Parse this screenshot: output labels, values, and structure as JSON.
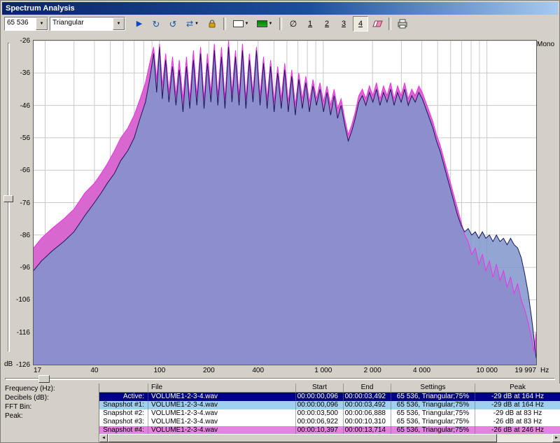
{
  "window": {
    "title": "Spectrum Analysis"
  },
  "icons": {
    "dropdown": "▼",
    "play": "▶",
    "refresh_cw": "↻",
    "refresh_ccw": "↺",
    "swap": "⇄",
    "no_symbol": "∅",
    "arrow_left": "◄",
    "arrow_right": "►"
  },
  "toolbar": {
    "fft_size_value": "65 536",
    "window_value": "Triangular",
    "snapshot_buttons": [
      "1",
      "2",
      "3",
      "4"
    ],
    "active_snapshot": "4"
  },
  "chart": {
    "mono_label": "Mono",
    "db_label": "dB",
    "hz_label": "Hz",
    "y_tick_labels": [
      "-26",
      "-36",
      "-46",
      "-56",
      "-66",
      "-76",
      "-86",
      "-96",
      "-106",
      "-116",
      "-126"
    ],
    "x_tick_labels": [
      {
        "f": 17,
        "label": "17"
      },
      {
        "f": 40,
        "label": "40"
      },
      {
        "f": 100,
        "label": "100"
      },
      {
        "f": 200,
        "label": "200"
      },
      {
        "f": 400,
        "label": "400"
      },
      {
        "f": 1000,
        "label": "1 000"
      },
      {
        "f": 2000,
        "label": "2 000"
      },
      {
        "f": 4000,
        "label": "4 000"
      },
      {
        "f": 10000,
        "label": "10 000"
      },
      {
        "f": 19997,
        "label": "19 997"
      }
    ],
    "grid_freqs": [
      20,
      30,
      40,
      50,
      60,
      70,
      80,
      90,
      100,
      200,
      300,
      400,
      500,
      600,
      700,
      800,
      900,
      1000,
      2000,
      3000,
      4000,
      5000,
      6000,
      7000,
      8000,
      9000,
      10000
    ],
    "y_grid_db": [
      -26,
      -36,
      -46,
      -56,
      -66,
      -76,
      -86,
      -96,
      -106,
      -116,
      -126
    ]
  },
  "chart_data": {
    "type": "area",
    "x_scale": "log",
    "xlim": [
      17,
      19997
    ],
    "ylim": [
      -126,
      -26
    ],
    "xlabel": "Frequency (Hz)",
    "ylabel": "Decibels (dB)",
    "legend": "none",
    "series": [
      {
        "name": "Snapshot #4",
        "stroke": "#f030e8",
        "fill": "#d867d0",
        "points": [
          [
            17,
            -90
          ],
          [
            19,
            -87
          ],
          [
            22,
            -84
          ],
          [
            26,
            -81
          ],
          [
            30,
            -78
          ],
          [
            35,
            -73
          ],
          [
            40,
            -70
          ],
          [
            44,
            -67
          ],
          [
            48,
            -64
          ],
          [
            53,
            -60
          ],
          [
            58,
            -56
          ],
          [
            64,
            -53
          ],
          [
            70,
            -49
          ],
          [
            76,
            -44
          ],
          [
            82,
            -39
          ],
          [
            87,
            -33
          ],
          [
            92,
            -28
          ],
          [
            96,
            -38
          ],
          [
            100,
            -27
          ],
          [
            104,
            -40
          ],
          [
            109,
            -30
          ],
          [
            114,
            -42
          ],
          [
            120,
            -31
          ],
          [
            126,
            -43
          ],
          [
            132,
            -32
          ],
          [
            139,
            -44
          ],
          [
            146,
            -31
          ],
          [
            153,
            -44
          ],
          [
            161,
            -29
          ],
          [
            169,
            -43
          ],
          [
            178,
            -28
          ],
          [
            187,
            -44
          ],
          [
            196,
            -30
          ],
          [
            206,
            -42
          ],
          [
            216,
            -27
          ],
          [
            227,
            -43
          ],
          [
            239,
            -28
          ],
          [
            251,
            -44
          ],
          [
            264,
            -26
          ],
          [
            277,
            -42
          ],
          [
            291,
            -29
          ],
          [
            306,
            -43
          ],
          [
            321,
            -27
          ],
          [
            337,
            -44
          ],
          [
            354,
            -30
          ],
          [
            372,
            -42
          ],
          [
            391,
            -28
          ],
          [
            411,
            -43
          ],
          [
            432,
            -31
          ],
          [
            454,
            -44
          ],
          [
            477,
            -32
          ],
          [
            501,
            -45
          ],
          [
            527,
            -34
          ],
          [
            554,
            -44
          ],
          [
            582,
            -33
          ],
          [
            611,
            -45
          ],
          [
            642,
            -35
          ],
          [
            675,
            -46
          ],
          [
            709,
            -36
          ],
          [
            745,
            -44
          ],
          [
            783,
            -37
          ],
          [
            823,
            -45
          ],
          [
            865,
            -38
          ],
          [
            909,
            -44
          ],
          [
            955,
            -39
          ],
          [
            1004,
            -45
          ],
          [
            1055,
            -40
          ],
          [
            1109,
            -46
          ],
          [
            1165,
            -41
          ],
          [
            1224,
            -47
          ],
          [
            1286,
            -44
          ],
          [
            1352,
            -50
          ],
          [
            1421,
            -55
          ],
          [
            1493,
            -52
          ],
          [
            1569,
            -48
          ],
          [
            1649,
            -43
          ],
          [
            1733,
            -41
          ],
          [
            1821,
            -44
          ],
          [
            1914,
            -40
          ],
          [
            2011,
            -43
          ],
          [
            2113,
            -39
          ],
          [
            2221,
            -44
          ],
          [
            2334,
            -40
          ],
          [
            2453,
            -43
          ],
          [
            2578,
            -39
          ],
          [
            2709,
            -44
          ],
          [
            2847,
            -40
          ],
          [
            2992,
            -43
          ],
          [
            3144,
            -39
          ],
          [
            3304,
            -44
          ],
          [
            3472,
            -41
          ],
          [
            3649,
            -43
          ],
          [
            3835,
            -40
          ],
          [
            4030,
            -42
          ],
          [
            4235,
            -45
          ],
          [
            4451,
            -48
          ],
          [
            4677,
            -51
          ],
          [
            4915,
            -55
          ],
          [
            5166,
            -58
          ],
          [
            5429,
            -62
          ],
          [
            5705,
            -66
          ],
          [
            5996,
            -70
          ],
          [
            6301,
            -74
          ],
          [
            6622,
            -78
          ],
          [
            6959,
            -82
          ],
          [
            7313,
            -86
          ],
          [
            7686,
            -88
          ],
          [
            8077,
            -92
          ],
          [
            8488,
            -90
          ],
          [
            8921,
            -95
          ],
          [
            9375,
            -92
          ],
          [
            9852,
            -97
          ],
          [
            10354,
            -94
          ],
          [
            10881,
            -99
          ],
          [
            11435,
            -95
          ],
          [
            12018,
            -100
          ],
          [
            12630,
            -97
          ],
          [
            13273,
            -102
          ],
          [
            13949,
            -99
          ],
          [
            14659,
            -104
          ],
          [
            15406,
            -101
          ],
          [
            16190,
            -106
          ],
          [
            17014,
            -109
          ],
          [
            17881,
            -113
          ],
          [
            18791,
            -118
          ],
          [
            19300,
            -122
          ],
          [
            19650,
            -119
          ],
          [
            19997,
            -116
          ]
        ]
      },
      {
        "name": "Active",
        "stroke": "#18185e",
        "fill": "rgba(128,150,203,0.85)",
        "points": [
          [
            17,
            -97
          ],
          [
            19,
            -94
          ],
          [
            22,
            -91
          ],
          [
            26,
            -88
          ],
          [
            30,
            -85
          ],
          [
            35,
            -80
          ],
          [
            40,
            -76
          ],
          [
            44,
            -73
          ],
          [
            48,
            -70
          ],
          [
            53,
            -67
          ],
          [
            58,
            -63
          ],
          [
            64,
            -60
          ],
          [
            70,
            -56
          ],
          [
            76,
            -50
          ],
          [
            82,
            -45
          ],
          [
            87,
            -38
          ],
          [
            92,
            -30
          ],
          [
            96,
            -42
          ],
          [
            100,
            -28
          ],
          [
            104,
            -44
          ],
          [
            109,
            -32
          ],
          [
            114,
            -45
          ],
          [
            120,
            -34
          ],
          [
            126,
            -46
          ],
          [
            132,
            -35
          ],
          [
            139,
            -48
          ],
          [
            146,
            -34
          ],
          [
            153,
            -47
          ],
          [
            161,
            -32
          ],
          [
            169,
            -46
          ],
          [
            178,
            -30
          ],
          [
            187,
            -47
          ],
          [
            196,
            -33
          ],
          [
            206,
            -45
          ],
          [
            216,
            -29
          ],
          [
            227,
            -46
          ],
          [
            239,
            -31
          ],
          [
            251,
            -47
          ],
          [
            264,
            -28
          ],
          [
            277,
            -45
          ],
          [
            291,
            -31
          ],
          [
            306,
            -46
          ],
          [
            321,
            -29
          ],
          [
            337,
            -47
          ],
          [
            354,
            -32
          ],
          [
            372,
            -45
          ],
          [
            391,
            -29
          ],
          [
            411,
            -46
          ],
          [
            432,
            -33
          ],
          [
            454,
            -47
          ],
          [
            477,
            -34
          ],
          [
            501,
            -48
          ],
          [
            527,
            -36
          ],
          [
            554,
            -47
          ],
          [
            582,
            -35
          ],
          [
            611,
            -48
          ],
          [
            642,
            -37
          ],
          [
            675,
            -49
          ],
          [
            709,
            -38
          ],
          [
            745,
            -47
          ],
          [
            783,
            -39
          ],
          [
            823,
            -48
          ],
          [
            865,
            -40
          ],
          [
            909,
            -46
          ],
          [
            955,
            -41
          ],
          [
            1004,
            -48
          ],
          [
            1055,
            -42
          ],
          [
            1109,
            -49
          ],
          [
            1165,
            -43
          ],
          [
            1224,
            -50
          ],
          [
            1286,
            -46
          ],
          [
            1352,
            -52
          ],
          [
            1421,
            -57
          ],
          [
            1493,
            -54
          ],
          [
            1569,
            -50
          ],
          [
            1649,
            -45
          ],
          [
            1733,
            -43
          ],
          [
            1821,
            -46
          ],
          [
            1914,
            -42
          ],
          [
            2011,
            -45
          ],
          [
            2113,
            -41
          ],
          [
            2221,
            -46
          ],
          [
            2334,
            -42
          ],
          [
            2453,
            -45
          ],
          [
            2578,
            -41
          ],
          [
            2709,
            -46
          ],
          [
            2847,
            -42
          ],
          [
            2992,
            -45
          ],
          [
            3144,
            -41
          ],
          [
            3304,
            -46
          ],
          [
            3472,
            -43
          ],
          [
            3649,
            -45
          ],
          [
            3835,
            -42
          ],
          [
            4030,
            -44
          ],
          [
            4235,
            -47
          ],
          [
            4451,
            -50
          ],
          [
            4677,
            -53
          ],
          [
            4915,
            -57
          ],
          [
            5166,
            -60
          ],
          [
            5429,
            -64
          ],
          [
            5705,
            -68
          ],
          [
            5996,
            -72
          ],
          [
            6301,
            -76
          ],
          [
            6622,
            -80
          ],
          [
            6959,
            -83
          ],
          [
            7313,
            -85
          ],
          [
            7686,
            -84
          ],
          [
            8077,
            -86
          ],
          [
            8488,
            -85
          ],
          [
            8921,
            -87
          ],
          [
            9375,
            -85
          ],
          [
            9852,
            -87
          ],
          [
            10354,
            -86
          ],
          [
            10881,
            -88
          ],
          [
            11435,
            -86
          ],
          [
            12018,
            -88
          ],
          [
            12630,
            -87
          ],
          [
            13273,
            -89
          ],
          [
            13949,
            -87
          ],
          [
            14659,
            -89
          ],
          [
            15406,
            -90
          ],
          [
            16190,
            -93
          ],
          [
            17014,
            -98
          ],
          [
            17881,
            -104
          ],
          [
            18791,
            -112
          ],
          [
            19300,
            -117
          ],
          [
            19650,
            -121
          ],
          [
            19997,
            -124
          ]
        ]
      }
    ]
  },
  "bottom": {
    "field_labels": [
      "Frequency (Hz):",
      "Decibels (dB):",
      "FFT Bin:",
      "Peak:"
    ],
    "table": {
      "headers": {
        "file": "File",
        "start": "Start",
        "end": "End",
        "settings": "Settings",
        "peak": "Peak"
      },
      "rows": [
        {
          "label": "Active:",
          "file": "VOLUME1-2-3-4.wav",
          "start": "00:00:00,096",
          "end": "00:00:03,492",
          "settings": "65 536, Triangular;75%",
          "peak": "-29 dB at 164 Hz",
          "bg": "#000080",
          "fg": "#ffffff"
        },
        {
          "label": "Snapshot #1:",
          "file": "VOLUME1-2-3-4.wav",
          "start": "00:00:00,096",
          "end": "00:00:03,492",
          "settings": "65 536, Triangular;75%",
          "peak": "-29 dB at 164 Hz",
          "bg": "#9fd0ee",
          "fg": "#000000"
        },
        {
          "label": "Snapshot #2:",
          "file": "VOLUME1-2-3-4.wav",
          "start": "00:00:03,500",
          "end": "00:00:06,888",
          "settings": "65 536, Triangular;75%",
          "peak": "-29 dB at 83 Hz",
          "bg": "#ffffff",
          "fg": "#000000"
        },
        {
          "label": "Snapshot #3:",
          "file": "VOLUME1-2-3-4.wav",
          "start": "00:00:06,922",
          "end": "00:00:10,310",
          "settings": "65 536, Triangular;75%",
          "peak": "-26 dB at 83 Hz",
          "bg": "#ffffff",
          "fg": "#000000"
        },
        {
          "label": "Snapshot #4:",
          "file": "VOLUME1-2-3-4.wav",
          "start": "00:00:10,397",
          "end": "00:00:13,714",
          "settings": "65 536, Triangular;75%",
          "peak": "-26 dB at 246 Hz",
          "bg": "#e583e0",
          "fg": "#000000"
        }
      ]
    }
  }
}
